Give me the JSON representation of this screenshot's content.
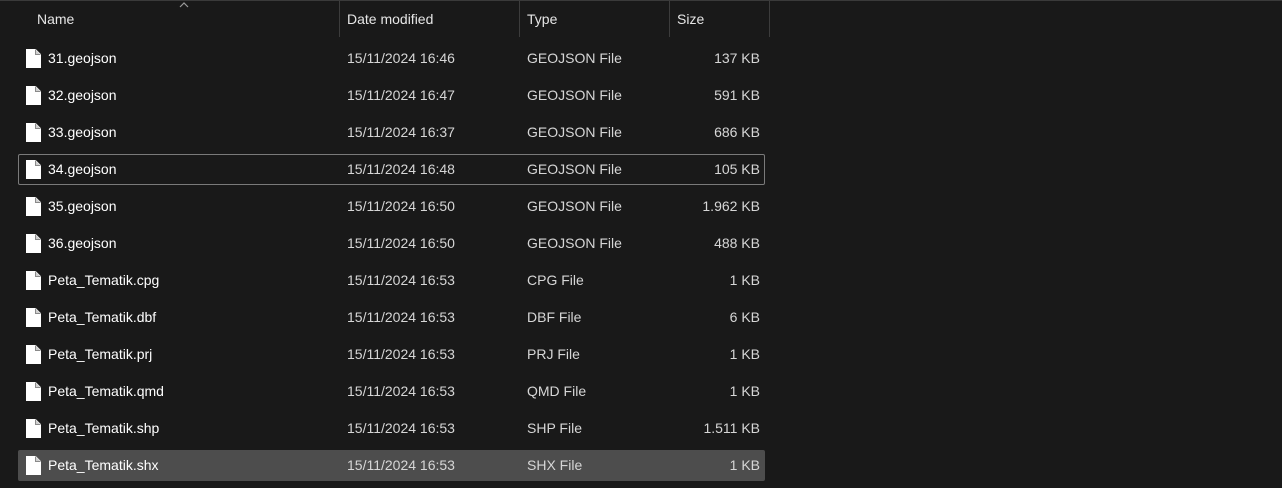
{
  "columns": {
    "name": "Name",
    "date_modified": "Date modified",
    "type": "Type",
    "size": "Size"
  },
  "sort": {
    "column": "name",
    "direction": "ascending"
  },
  "icons": {
    "file": "file-icon",
    "sort": "sort-ascending-icon"
  },
  "colors": {
    "background": "#191919",
    "selected_row": "#4d4d4d",
    "focus_border": "#7a7a7a",
    "text": "#ffffff"
  },
  "files": [
    {
      "name": "31.geojson",
      "date": "15/11/2024 16:46",
      "type": "GEOJSON File",
      "size": "137 KB"
    },
    {
      "name": "32.geojson",
      "date": "15/11/2024 16:47",
      "type": "GEOJSON File",
      "size": "591 KB"
    },
    {
      "name": "33.geojson",
      "date": "15/11/2024 16:37",
      "type": "GEOJSON File",
      "size": "686 KB"
    },
    {
      "name": "34.geojson",
      "date": "15/11/2024 16:48",
      "type": "GEOJSON File",
      "size": "105 KB",
      "state": "focused"
    },
    {
      "name": "35.geojson",
      "date": "15/11/2024 16:50",
      "type": "GEOJSON File",
      "size": "1.962 KB"
    },
    {
      "name": "36.geojson",
      "date": "15/11/2024 16:50",
      "type": "GEOJSON File",
      "size": "488 KB"
    },
    {
      "name": "Peta_Tematik.cpg",
      "date": "15/11/2024 16:53",
      "type": "CPG File",
      "size": "1 KB"
    },
    {
      "name": "Peta_Tematik.dbf",
      "date": "15/11/2024 16:53",
      "type": "DBF File",
      "size": "6 KB"
    },
    {
      "name": "Peta_Tematik.prj",
      "date": "15/11/2024 16:53",
      "type": "PRJ File",
      "size": "1 KB"
    },
    {
      "name": "Peta_Tematik.qmd",
      "date": "15/11/2024 16:53",
      "type": "QMD File",
      "size": "1 KB"
    },
    {
      "name": "Peta_Tematik.shp",
      "date": "15/11/2024 16:53",
      "type": "SHP File",
      "size": "1.511 KB"
    },
    {
      "name": "Peta_Tematik.shx",
      "date": "15/11/2024 16:53",
      "type": "SHX File",
      "size": "1 KB",
      "state": "selected"
    }
  ]
}
